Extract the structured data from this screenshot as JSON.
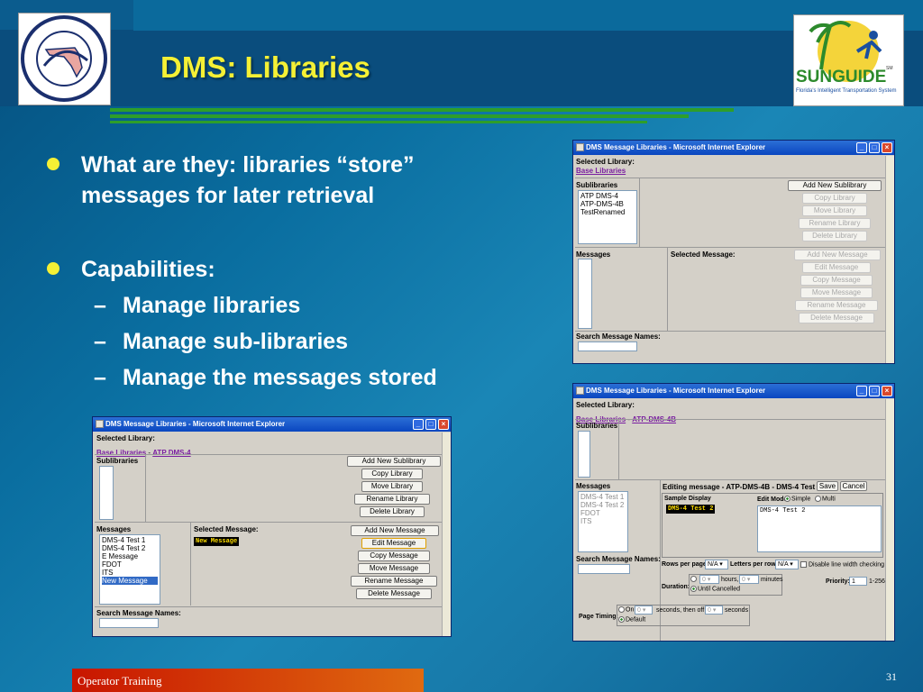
{
  "slide": {
    "title": "DMS: Libraries",
    "footer": "Operator Training",
    "page": "31",
    "bullets": [
      {
        "line1": "What are they: libraries “store”",
        "line2": "messages for later retrieval"
      },
      {
        "line1": "Capabilities:"
      }
    ],
    "subs": [
      "Manage libraries",
      "Manage sub-libraries",
      "Manage the messages stored"
    ],
    "dash": "–",
    "logo_fdot": "STATE OF FLORIDA • DEPARTMENT OF TRANSPORTATION",
    "logo_sun": "SUNGUIDE",
    "logo_sun_sm": "SM",
    "logo_sun_tag": "Florida's Intelligent Transportation System"
  },
  "colors": {
    "title": "#f5f035",
    "bullet": "#f5f035",
    "rule": "#2e9e2a",
    "footer": "#c81500",
    "link": "#7a1fa0",
    "titlebar": "#0a46c0"
  },
  "win_top": {
    "title": "DMS Message Libraries - Microsoft Internet Explorer",
    "selected_library": "Selected Library:",
    "path": "Base Libraries",
    "sublibraries": "Sublibraries",
    "sub_items": [
      "ATP DMS-4",
      "ATP-DMS-4B",
      "TestRenamed"
    ],
    "lib_buttons": [
      "Add New Sublibrary",
      "Copy Library",
      "Move Library",
      "Rename Library",
      "Delete Library"
    ],
    "messages": "Messages",
    "selected_message": "Selected Message:",
    "msg_buttons": [
      "Add New Message",
      "Edit Message",
      "Copy Message",
      "Move Message",
      "Rename Message",
      "Delete Message"
    ],
    "search": "Search Message Names:"
  },
  "win_left": {
    "title": "DMS Message Libraries - Microsoft Internet Explorer",
    "selected_library": "Selected Library:",
    "path1": "Base Libraries",
    "sep": " - ",
    "path2": "ATP DMS-4",
    "sublibraries": "Sublibraries",
    "lib_buttons": [
      "Add New Sublibrary",
      "Copy Library",
      "Move Library",
      "Rename Library",
      "Delete Library"
    ],
    "messages": "Messages",
    "msg_items": [
      "DMS-4 Test 1",
      "DMS-4 Test 2",
      "E Message",
      "FDOT",
      "ITS",
      "New Message"
    ],
    "selected_message": "Selected Message:",
    "preview": "New Message",
    "msg_buttons": [
      "Add New Message",
      "Edit Message",
      "Copy Message",
      "Move Message",
      "Rename Message",
      "Delete Message"
    ],
    "search": "Search Message Names:"
  },
  "win_bottom": {
    "title": "DMS Message Libraries - Microsoft Internet Explorer",
    "selected_library": "Selected Library:",
    "path1": "Base Libraries",
    "sep": " - ",
    "path2": "ATP-DMS-4B",
    "sublibraries": "Sublibraries",
    "messages": "Messages",
    "msg_items": [
      "DMS-4 Test 1",
      "DMS-4 Test 2",
      "FDOT",
      "ITS"
    ],
    "editing": "Editing message - ATP-DMS-4B - DMS-4 Test 2",
    "save": "Save",
    "cancel": "Cancel",
    "sample_display": "Sample Display",
    "sample_text": "DMS-4 Test 2",
    "edit_mode": "Edit Mode",
    "simple": "Simple",
    "multi": "Multi",
    "editor_text": "DMS-4 Test 2",
    "search": "Search Message Names:",
    "rows_per_page": "Rows per page:",
    "rows_val": "N/A",
    "letters_per_row": "Letters per row:",
    "letters_val": "N/A",
    "line_width": "Disable line width checking",
    "duration": "Duration:",
    "hours_val": "0",
    "hours": "hours,",
    "minutes_val": "0",
    "minutes": "minutes",
    "until_cancelled": "Until Cancelled",
    "priority": "Priority:",
    "priority_val": "1",
    "priority_range": "1-256",
    "page_timing": "Page Timing:",
    "on": "On",
    "on_val": "0",
    "then_off": "seconds, then off",
    "off_val": "0",
    "seconds": "seconds",
    "default": "Default"
  }
}
